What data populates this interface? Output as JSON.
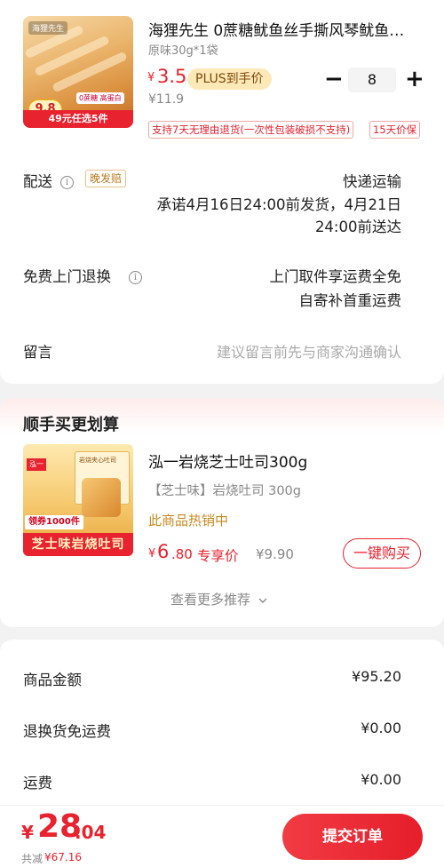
{
  "product": {
    "title": "海狸先生 0蔗糖鱿鱼丝手撕风琴鱿鱼…",
    "variant": "原味30g*1袋",
    "price_symbol": "¥",
    "price": "3.5",
    "plus_tag": "PLUS到手价",
    "original_price": "¥11.9",
    "quantity": "8",
    "minus_label": "−",
    "plus_label": "+",
    "image": {
      "brand": "海狸先生",
      "tag": "0蔗糖 高蛋白",
      "badge": "9.8",
      "bar": "49元任选5件"
    },
    "service_tags": [
      "支持7天无理由退货(一次性包装破损不支持)",
      "15天价保"
    ]
  },
  "delivery": {
    "label": "配送",
    "tag": "晚发赔",
    "method": "快递运输",
    "promise_line1": "承诺4月16日24:00前发货，4月21日",
    "promise_line2": "24:00前送达"
  },
  "returns": {
    "label": "免费上门退换",
    "line1": "上门取件享运费全免",
    "line2": "自寄补首重运费"
  },
  "message": {
    "label": "留言",
    "placeholder": "建议留言前先与商家沟通确认"
  },
  "recommend": {
    "section_title": "顺手买更划算",
    "item": {
      "title": "泓一岩烧芝士吐司300g",
      "variant": "【芝士味】岩烧吐司 300g",
      "hot": "此商品热销中",
      "price_symbol": "¥",
      "price_int": "6",
      "price_dec": ".80",
      "exclusive": "专享价",
      "original": "¥9.90",
      "buy_label": "一键购买",
      "image": {
        "logo": "泓一",
        "box": "岩烧夹心吐司",
        "tag": "领券1000件",
        "bottom": "芝士味岩烧吐司"
      }
    },
    "more": "查看更多推荐"
  },
  "summary": {
    "rows": [
      {
        "label": "商品金额",
        "value": "¥95.20"
      },
      {
        "label": "退换货免运费",
        "value": "¥0.00"
      },
      {
        "label": "运费",
        "value": "¥0.00"
      }
    ]
  },
  "footer": {
    "symbol": "¥",
    "total_int": "28",
    "total_dec": ".04",
    "saved_label": "共减",
    "saved_value": "¥67.16",
    "submit_label": "提交订单"
  },
  "colors": {
    "accent": "#e8222e",
    "plus_tag_bg": "#fde9b8",
    "hot_text": "#c98a1e"
  }
}
